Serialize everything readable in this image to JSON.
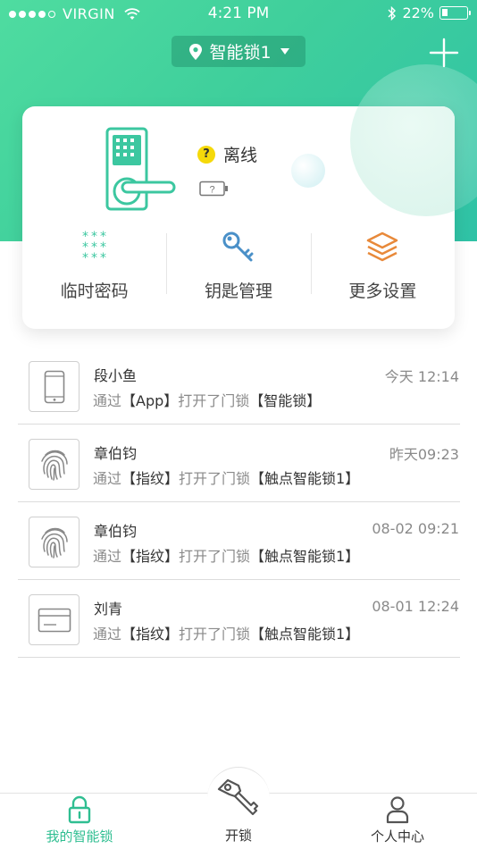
{
  "statusbar": {
    "carrier": "VIRGIN",
    "time": "4:21 PM",
    "battery": "22%"
  },
  "header": {
    "lock_name": "智能锁1"
  },
  "device": {
    "status": "离线",
    "badge": "?"
  },
  "actions": [
    {
      "label": "临时密码",
      "icon": "keypad-icon"
    },
    {
      "label": "钥匙管理",
      "icon": "key-icon"
    },
    {
      "label": "更多设置",
      "icon": "layers-icon"
    }
  ],
  "logs": [
    {
      "name": "段小鱼",
      "time": "今天 12:14",
      "pre": "通过",
      "method": "【App】",
      "mid": "打开了门锁",
      "lock": "【智能锁】",
      "icon": "phone-icon"
    },
    {
      "name": "章伯钧",
      "time": "昨天09:23",
      "pre": "通过",
      "method": "【指纹】",
      "mid": "打开了门锁",
      "lock": "【触点智能锁1】",
      "icon": "fingerprint-icon"
    },
    {
      "name": "章伯钧",
      "time": "08-02 09:21",
      "pre": "通过",
      "method": "【指纹】",
      "mid": "打开了门锁",
      "lock": "【触点智能锁1】",
      "icon": "fingerprint-icon"
    },
    {
      "name": "刘青",
      "time": "08-01 12:24",
      "pre": "通过",
      "method": "【指纹】",
      "mid": "打开了门锁",
      "lock": "【触点智能锁1】",
      "icon": "card-icon"
    }
  ],
  "tabbar": {
    "mine": "我的智能锁",
    "unlock": "开锁",
    "user": "个人中心"
  },
  "colors": {
    "accent": "#2fbe91",
    "hero_start": "#4fdca0",
    "hero_end": "#2fc2a6",
    "keypad": "#3cc7a0",
    "key": "#4a90c8",
    "layers": "#e8893a"
  }
}
